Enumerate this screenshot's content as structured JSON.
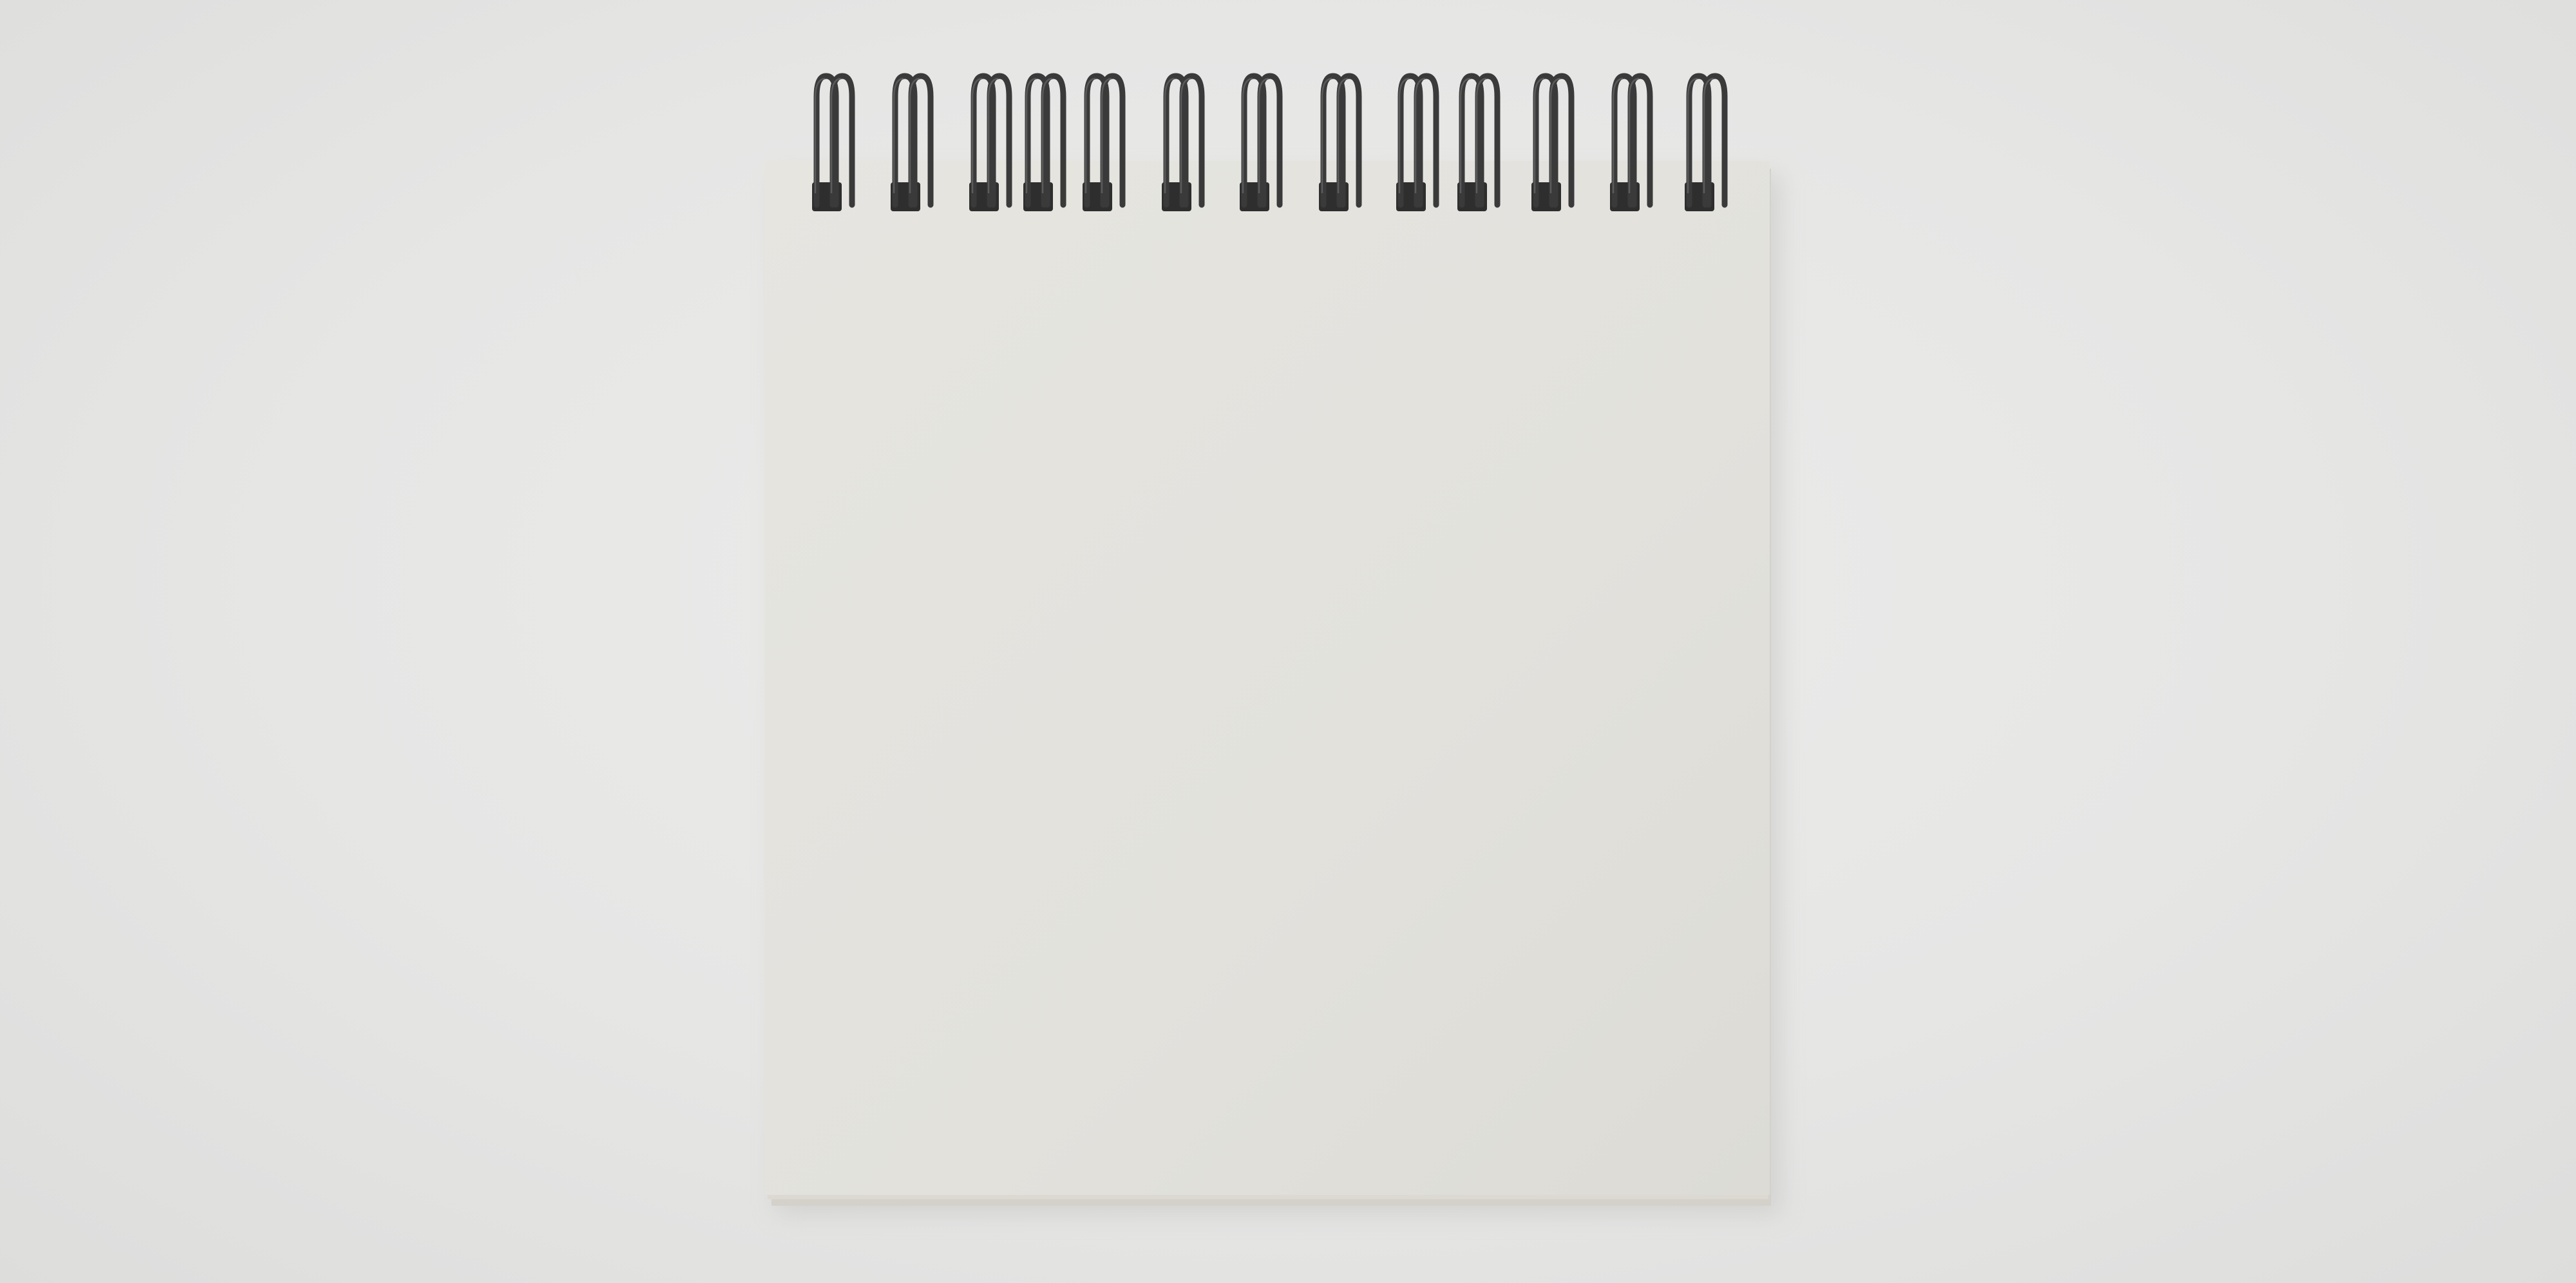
{
  "scene": {
    "subject": "spiral-notebook",
    "state": "closed, blank cover",
    "colors": {
      "background": "#e6e6e5",
      "paper": "#e4e3de",
      "paper_edge": "#d2d0c9",
      "coil": "#3a3a3a",
      "coil_highlight": "#6a6a6a",
      "shadow": "#c9c9c7"
    }
  },
  "notebook": {
    "binding": "top-spiral",
    "ring_count": 13
  }
}
